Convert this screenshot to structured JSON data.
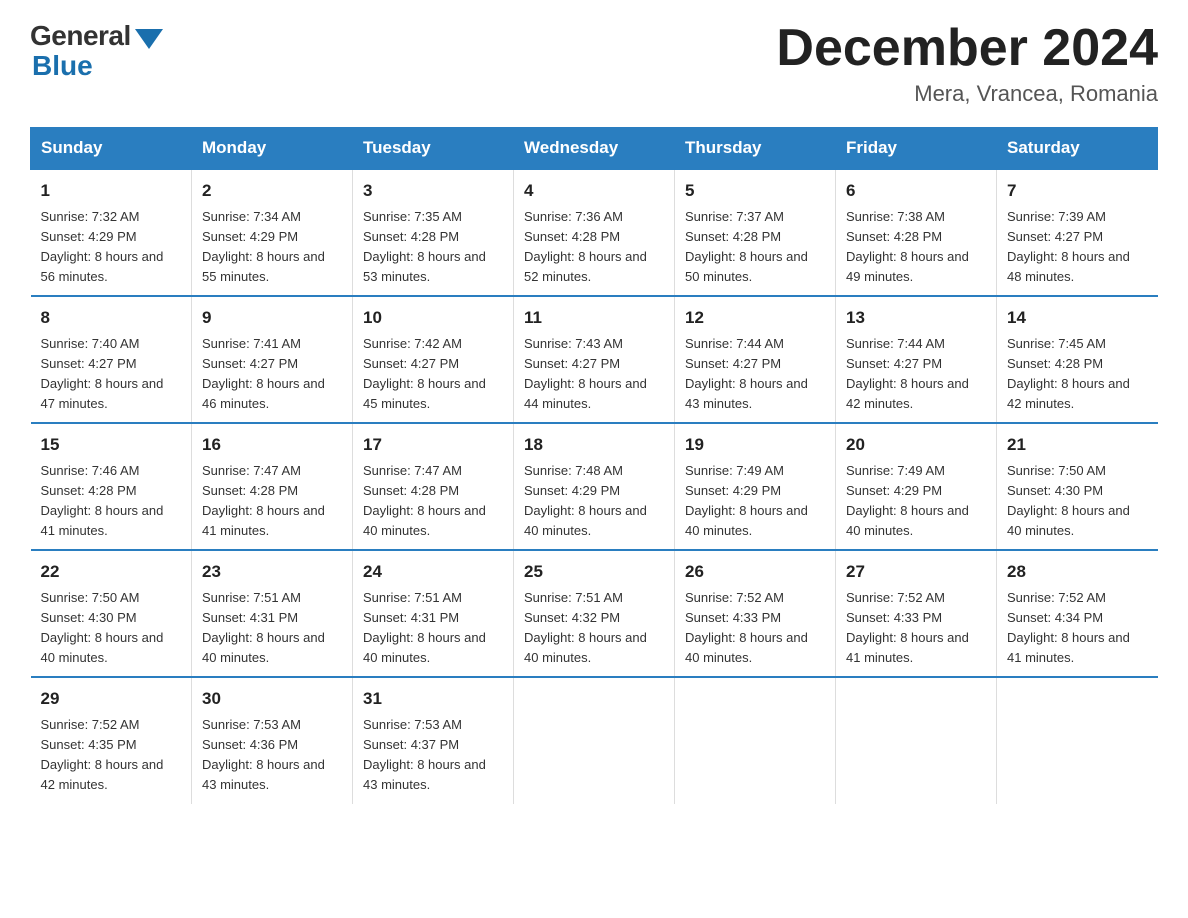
{
  "logo": {
    "general": "General",
    "blue": "Blue",
    "triangle": "▲"
  },
  "header": {
    "month_year": "December 2024",
    "location": "Mera, Vrancea, Romania"
  },
  "days_of_week": [
    "Sunday",
    "Monday",
    "Tuesday",
    "Wednesday",
    "Thursday",
    "Friday",
    "Saturday"
  ],
  "weeks": [
    [
      {
        "day": "1",
        "sunrise": "7:32 AM",
        "sunset": "4:29 PM",
        "daylight": "8 hours and 56 minutes."
      },
      {
        "day": "2",
        "sunrise": "7:34 AM",
        "sunset": "4:29 PM",
        "daylight": "8 hours and 55 minutes."
      },
      {
        "day": "3",
        "sunrise": "7:35 AM",
        "sunset": "4:28 PM",
        "daylight": "8 hours and 53 minutes."
      },
      {
        "day": "4",
        "sunrise": "7:36 AM",
        "sunset": "4:28 PM",
        "daylight": "8 hours and 52 minutes."
      },
      {
        "day": "5",
        "sunrise": "7:37 AM",
        "sunset": "4:28 PM",
        "daylight": "8 hours and 50 minutes."
      },
      {
        "day": "6",
        "sunrise": "7:38 AM",
        "sunset": "4:28 PM",
        "daylight": "8 hours and 49 minutes."
      },
      {
        "day": "7",
        "sunrise": "7:39 AM",
        "sunset": "4:27 PM",
        "daylight": "8 hours and 48 minutes."
      }
    ],
    [
      {
        "day": "8",
        "sunrise": "7:40 AM",
        "sunset": "4:27 PM",
        "daylight": "8 hours and 47 minutes."
      },
      {
        "day": "9",
        "sunrise": "7:41 AM",
        "sunset": "4:27 PM",
        "daylight": "8 hours and 46 minutes."
      },
      {
        "day": "10",
        "sunrise": "7:42 AM",
        "sunset": "4:27 PM",
        "daylight": "8 hours and 45 minutes."
      },
      {
        "day": "11",
        "sunrise": "7:43 AM",
        "sunset": "4:27 PM",
        "daylight": "8 hours and 44 minutes."
      },
      {
        "day": "12",
        "sunrise": "7:44 AM",
        "sunset": "4:27 PM",
        "daylight": "8 hours and 43 minutes."
      },
      {
        "day": "13",
        "sunrise": "7:44 AM",
        "sunset": "4:27 PM",
        "daylight": "8 hours and 42 minutes."
      },
      {
        "day": "14",
        "sunrise": "7:45 AM",
        "sunset": "4:28 PM",
        "daylight": "8 hours and 42 minutes."
      }
    ],
    [
      {
        "day": "15",
        "sunrise": "7:46 AM",
        "sunset": "4:28 PM",
        "daylight": "8 hours and 41 minutes."
      },
      {
        "day": "16",
        "sunrise": "7:47 AM",
        "sunset": "4:28 PM",
        "daylight": "8 hours and 41 minutes."
      },
      {
        "day": "17",
        "sunrise": "7:47 AM",
        "sunset": "4:28 PM",
        "daylight": "8 hours and 40 minutes."
      },
      {
        "day": "18",
        "sunrise": "7:48 AM",
        "sunset": "4:29 PM",
        "daylight": "8 hours and 40 minutes."
      },
      {
        "day": "19",
        "sunrise": "7:49 AM",
        "sunset": "4:29 PM",
        "daylight": "8 hours and 40 minutes."
      },
      {
        "day": "20",
        "sunrise": "7:49 AM",
        "sunset": "4:29 PM",
        "daylight": "8 hours and 40 minutes."
      },
      {
        "day": "21",
        "sunrise": "7:50 AM",
        "sunset": "4:30 PM",
        "daylight": "8 hours and 40 minutes."
      }
    ],
    [
      {
        "day": "22",
        "sunrise": "7:50 AM",
        "sunset": "4:30 PM",
        "daylight": "8 hours and 40 minutes."
      },
      {
        "day": "23",
        "sunrise": "7:51 AM",
        "sunset": "4:31 PM",
        "daylight": "8 hours and 40 minutes."
      },
      {
        "day": "24",
        "sunrise": "7:51 AM",
        "sunset": "4:31 PM",
        "daylight": "8 hours and 40 minutes."
      },
      {
        "day": "25",
        "sunrise": "7:51 AM",
        "sunset": "4:32 PM",
        "daylight": "8 hours and 40 minutes."
      },
      {
        "day": "26",
        "sunrise": "7:52 AM",
        "sunset": "4:33 PM",
        "daylight": "8 hours and 40 minutes."
      },
      {
        "day": "27",
        "sunrise": "7:52 AM",
        "sunset": "4:33 PM",
        "daylight": "8 hours and 41 minutes."
      },
      {
        "day": "28",
        "sunrise": "7:52 AM",
        "sunset": "4:34 PM",
        "daylight": "8 hours and 41 minutes."
      }
    ],
    [
      {
        "day": "29",
        "sunrise": "7:52 AM",
        "sunset": "4:35 PM",
        "daylight": "8 hours and 42 minutes."
      },
      {
        "day": "30",
        "sunrise": "7:53 AM",
        "sunset": "4:36 PM",
        "daylight": "8 hours and 43 minutes."
      },
      {
        "day": "31",
        "sunrise": "7:53 AM",
        "sunset": "4:37 PM",
        "daylight": "8 hours and 43 minutes."
      },
      null,
      null,
      null,
      null
    ]
  ],
  "labels": {
    "sunrise_prefix": "Sunrise: ",
    "sunset_prefix": "Sunset: ",
    "daylight_prefix": "Daylight: "
  }
}
